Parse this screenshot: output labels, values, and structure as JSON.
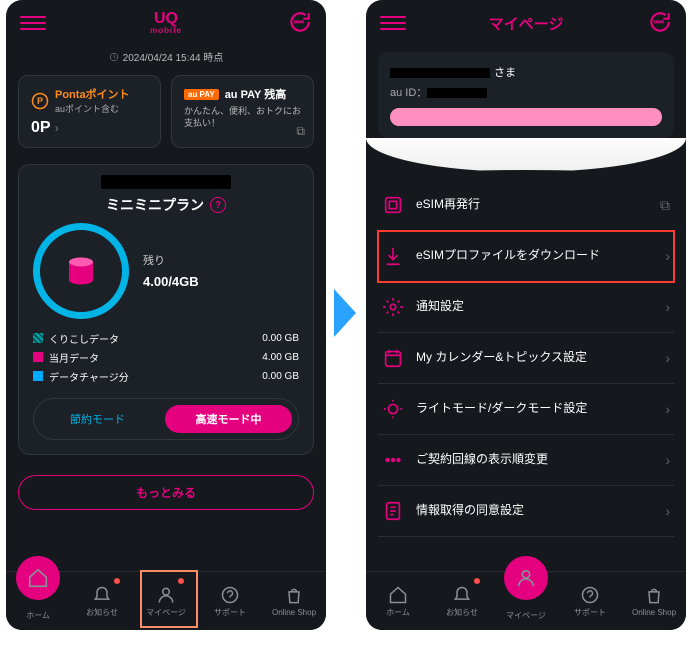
{
  "left": {
    "logo_top": "UQ",
    "logo_bottom": "mobile",
    "timestamp": "2024/04/24 15:44 時点",
    "ponta": {
      "title": "Pontaポイント",
      "sub": "auポイント含む",
      "value": "0P"
    },
    "aupay": {
      "tag": "au PAY",
      "title": "au PAY 残高",
      "desc": "かんたん、便利、おトクにお支払い！"
    },
    "plan_title": "ミニミニプラン",
    "remain_label": "残り",
    "remain_value": "4.00",
    "remain_total": "/4GB",
    "rows": [
      {
        "l": "くりこしデータ",
        "v": "0.00 GB"
      },
      {
        "l": "当月データ",
        "v": "4.00 GB"
      },
      {
        "l": "データチャージ分",
        "v": "0.00 GB"
      }
    ],
    "mode_save": "節約モード",
    "mode_fast": "高速モード中",
    "more": "もっとみる",
    "tabs": [
      "ホーム",
      "お知らせ",
      "マイページ",
      "サポート",
      "Online Shop"
    ]
  },
  "right": {
    "title": "マイページ",
    "user_suffix": "さま",
    "au_id": "au ID：",
    "items": [
      {
        "icon": "esim",
        "label": "eSIM再発行",
        "ext": true
      },
      {
        "icon": "download",
        "label": "eSIMプロファイルをダウンロード",
        "hi": true
      },
      {
        "icon": "gear",
        "label": "通知設定"
      },
      {
        "icon": "calendar",
        "label": "My カレンダー&トピックス設定"
      },
      {
        "icon": "theme",
        "label": "ライトモード/ダークモード設定"
      },
      {
        "icon": "dots",
        "label": "ご契約回線の表示順変更"
      },
      {
        "icon": "consent",
        "label": "情報取得の同意設定"
      }
    ],
    "tabs": [
      "ホーム",
      "お知らせ",
      "マイページ",
      "サポート",
      "Online Shop"
    ]
  }
}
